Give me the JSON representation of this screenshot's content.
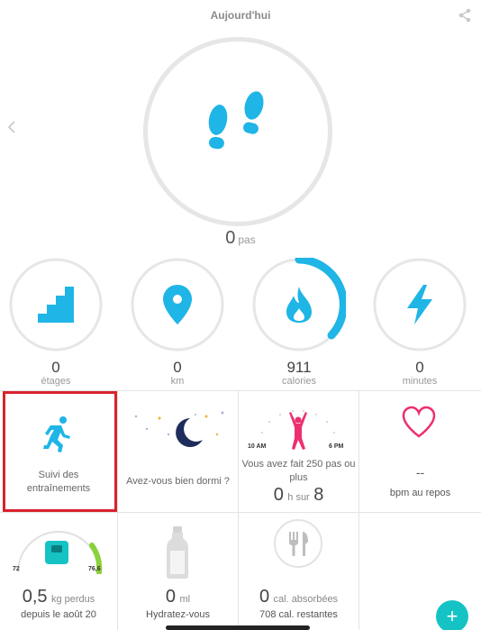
{
  "header": {
    "title": "Aujourd'hui"
  },
  "icons": {
    "share": "share-icon",
    "back": "chevron-left-icon",
    "steps": "footsteps-icon"
  },
  "colors": {
    "accent": "#1fb5e6",
    "ring": "#e6e6e6",
    "heart": "#ee2f6e",
    "exercise": "#1fb5e6",
    "teal": "#16c3c4",
    "highlight": "#d9232d"
  },
  "steps": {
    "value": "0",
    "unit": "pas"
  },
  "stats": [
    {
      "value": "0",
      "label": "étages",
      "icon": "stairs-icon",
      "progress": 0
    },
    {
      "value": "0",
      "label": "km",
      "icon": "location-pin-icon",
      "progress": 0
    },
    {
      "value": "911",
      "label": "calories",
      "icon": "flame-icon",
      "progress": 0.35
    },
    {
      "value": "0",
      "label": "minutes",
      "icon": "lightning-icon",
      "progress": 0
    }
  ],
  "tiles": {
    "exercise": {
      "label_line1": "Suivi des",
      "label_line2": "entraînements",
      "icon": "running-person-icon"
    },
    "sleep": {
      "label": "Avez-vous bien dormi ?",
      "icon": "moon-stars-icon"
    },
    "hourly": {
      "time_start": "10 AM",
      "time_end": "6 PM",
      "text_line1": "Vous avez fait 250 pas ou",
      "text_line2": "plus",
      "value": "0",
      "unit": "h sur",
      "goal": "8",
      "icon": "celebrating-person-icon"
    },
    "heart": {
      "value": "--",
      "label": "bpm au repos",
      "icon": "heart-icon"
    },
    "weight": {
      "scale_min": "72",
      "scale_max": "76,6",
      "value": "0,5",
      "unit": "kg perdus",
      "since": "depuis le août 20",
      "icon": "scale-icon",
      "progress": 0.2
    },
    "water": {
      "value": "0",
      "unit": "ml",
      "label": "Hydratez-vous",
      "icon": "water-bottle-icon"
    },
    "food": {
      "value": "0",
      "unit": "cal. absorbées",
      "remaining": "708 cal. restantes",
      "icon": "fork-knife-icon"
    }
  },
  "fab": {
    "label": "+"
  }
}
